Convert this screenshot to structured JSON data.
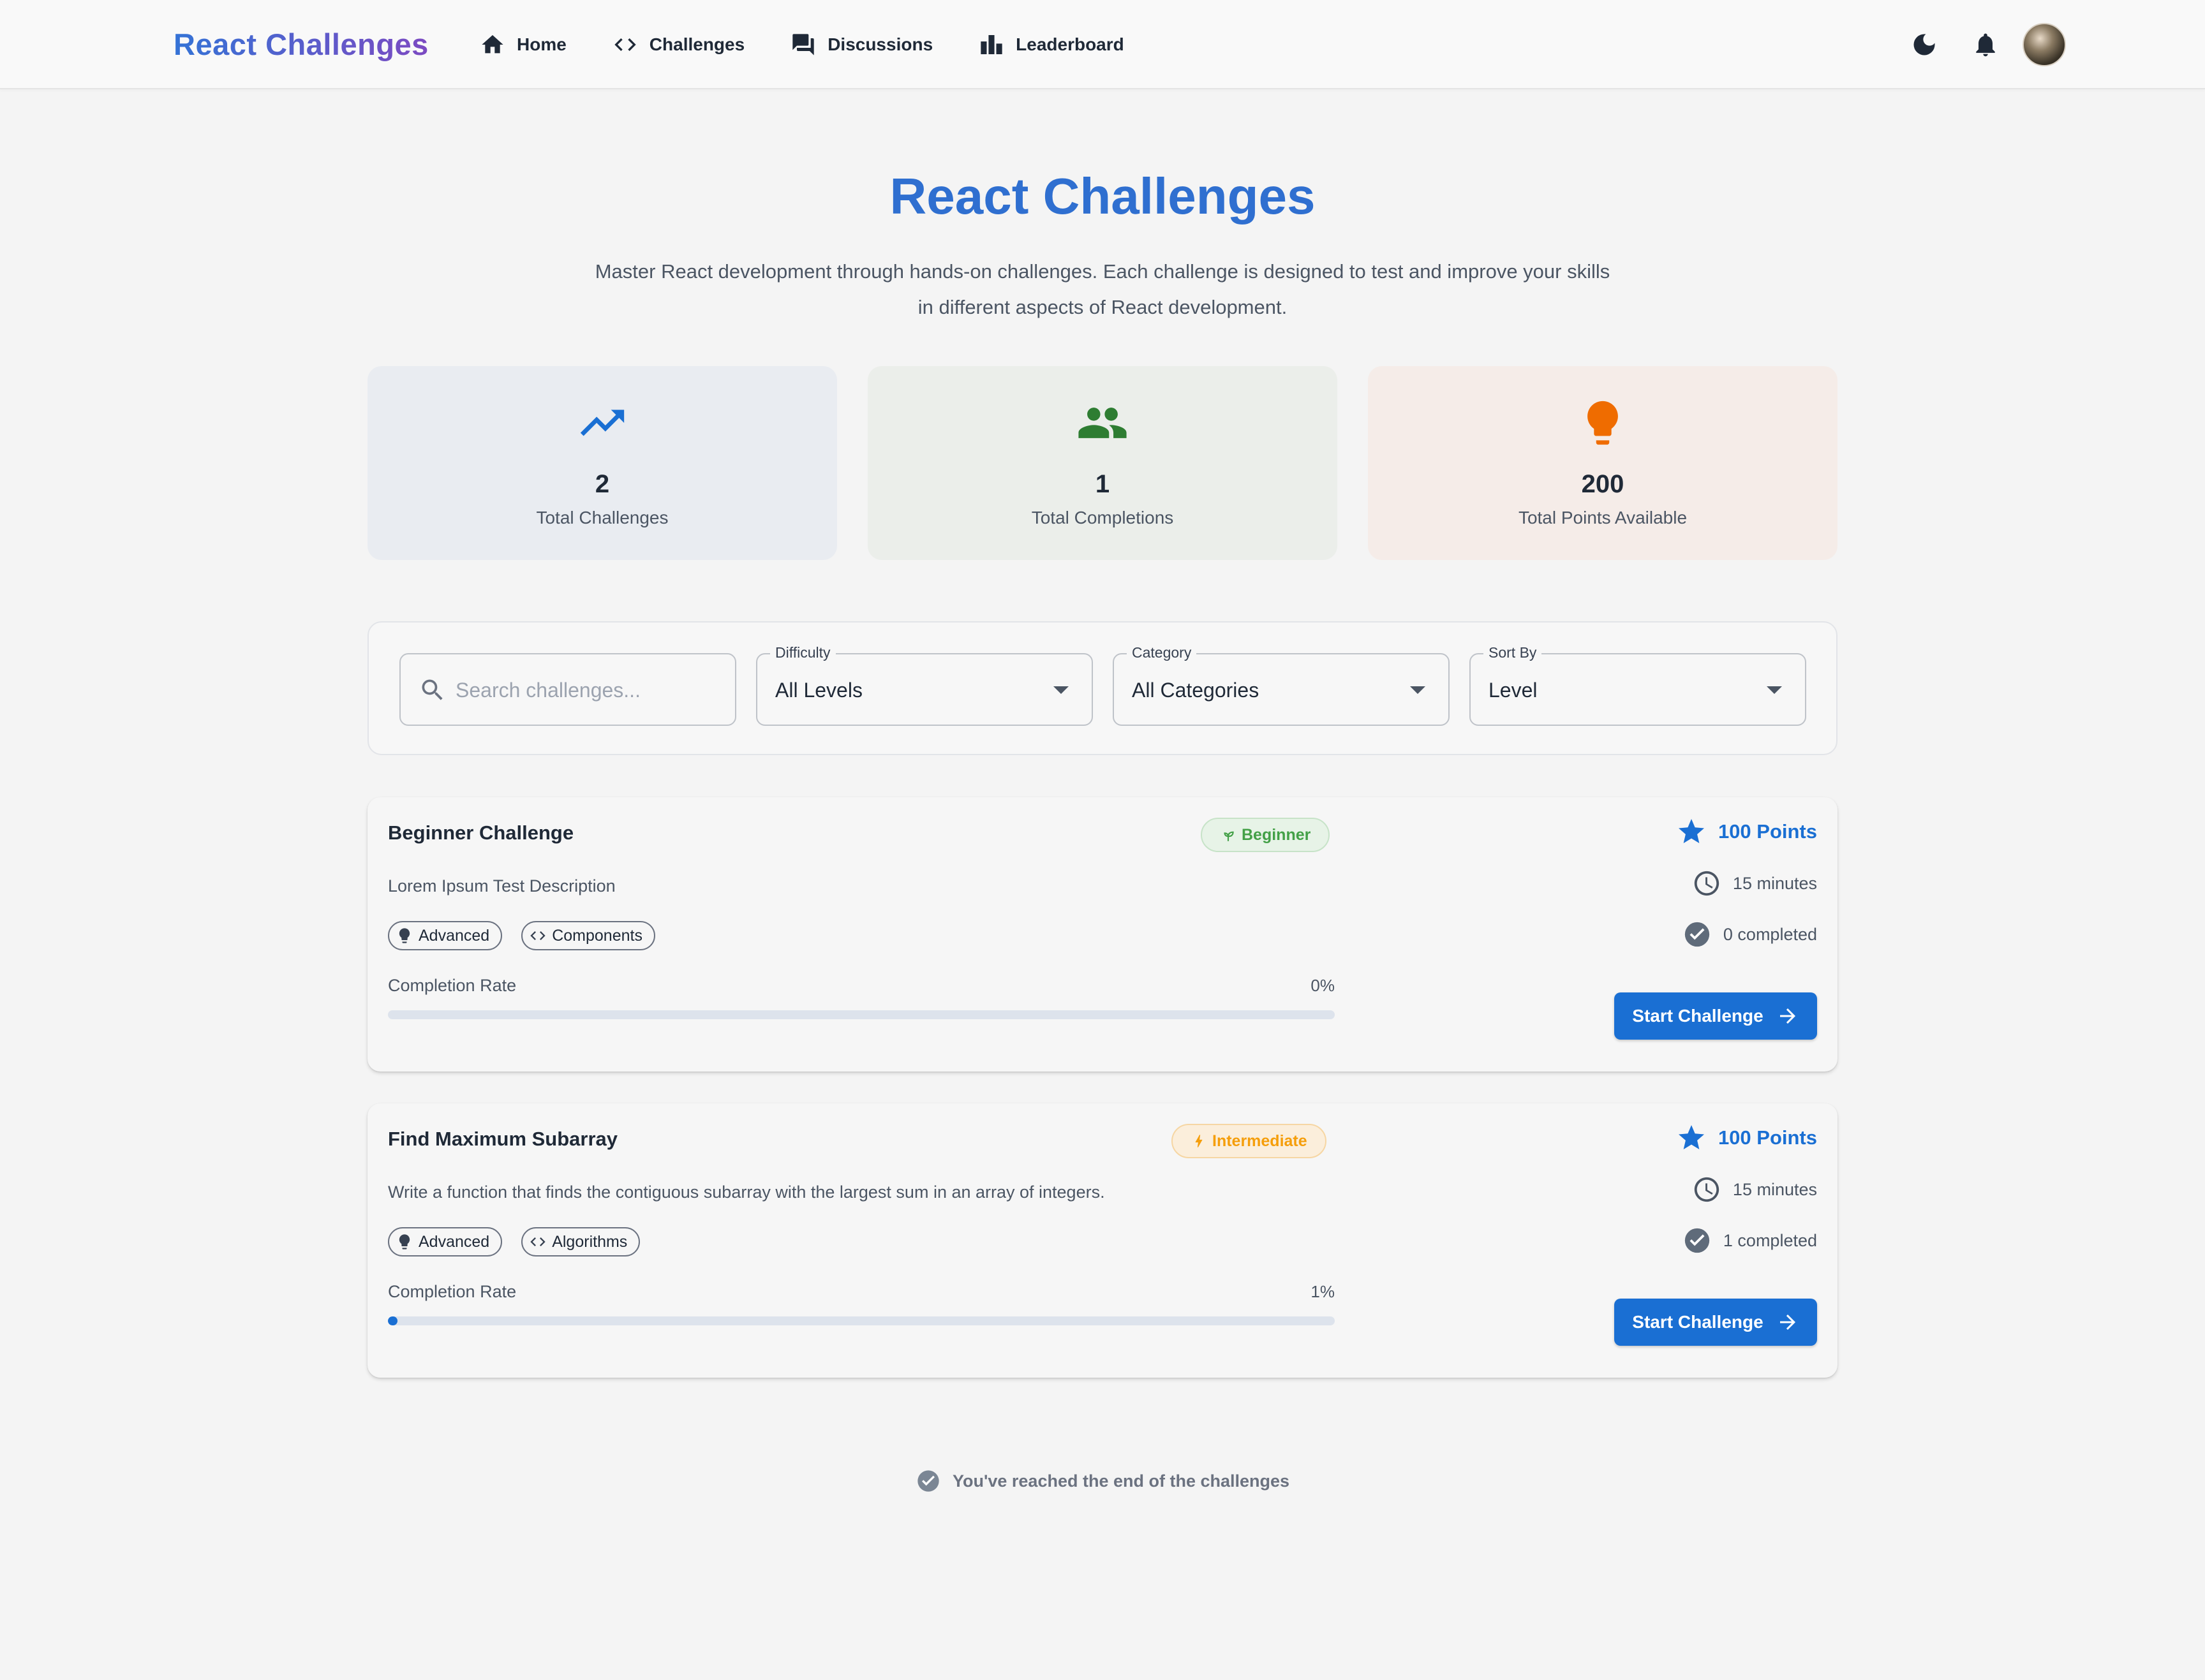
{
  "header": {
    "brand": "React Challenges",
    "nav": [
      {
        "label": "Home",
        "icon": "home-icon"
      },
      {
        "label": "Challenges",
        "icon": "code-icon"
      },
      {
        "label": "Discussions",
        "icon": "forum-icon"
      },
      {
        "label": "Leaderboard",
        "icon": "leaderboard-icon"
      }
    ],
    "actions": [
      "dark-mode-icon",
      "notifications-icon",
      "avatar"
    ]
  },
  "hero": {
    "title": "React Challenges",
    "subtitle": "Master React development through hands-on challenges. Each challenge is designed to test and improve your skills in different aspects of React development."
  },
  "stats": [
    {
      "value": "2",
      "label": "Total Challenges",
      "icon": "trending-up-icon",
      "color": "#1a6fd3",
      "bg": "#e9ecf1"
    },
    {
      "value": "1",
      "label": "Total Completions",
      "icon": "group-icon",
      "color": "#2e7d32",
      "bg": "#ebeeea"
    },
    {
      "value": "200",
      "label": "Total Points Available",
      "icon": "lightbulb-icon",
      "color": "#ef6c00",
      "bg": "#f5ece8"
    }
  ],
  "filters": {
    "search_placeholder": "Search challenges...",
    "difficulty": {
      "label": "Difficulty",
      "value": "All Levels"
    },
    "category": {
      "label": "Category",
      "value": "All Categories"
    },
    "sort": {
      "label": "Sort By",
      "value": "Level"
    }
  },
  "challenges": [
    {
      "title": "Beginner Challenge",
      "level": "Beginner",
      "level_color": "#4caf50",
      "level_bg": "#e7f3e7",
      "description": "Lorem Ipsum Test Description",
      "tags": [
        "Advanced",
        "Components"
      ],
      "rate_label": "Completion Rate",
      "rate_text": "0%",
      "rate": 0,
      "points": "100 Points",
      "time": "15 minutes",
      "completed": "0 completed",
      "button": "Start Challenge"
    },
    {
      "title": "Find Maximum Subarray",
      "level": "Intermediate",
      "level_color": "#f59e0b",
      "level_bg": "#fbeedb",
      "description": "Write a function that finds the contiguous subarray with the largest sum in an array of integers.",
      "tags": [
        "Advanced",
        "Algorithms"
      ],
      "rate_label": "Completion Rate",
      "rate_text": "1%",
      "rate": 0.01,
      "points": "100 Points",
      "time": "15 minutes",
      "completed": "1 completed",
      "button": "Start Challenge"
    }
  ],
  "end_note": "You've reached the end of the challenges"
}
